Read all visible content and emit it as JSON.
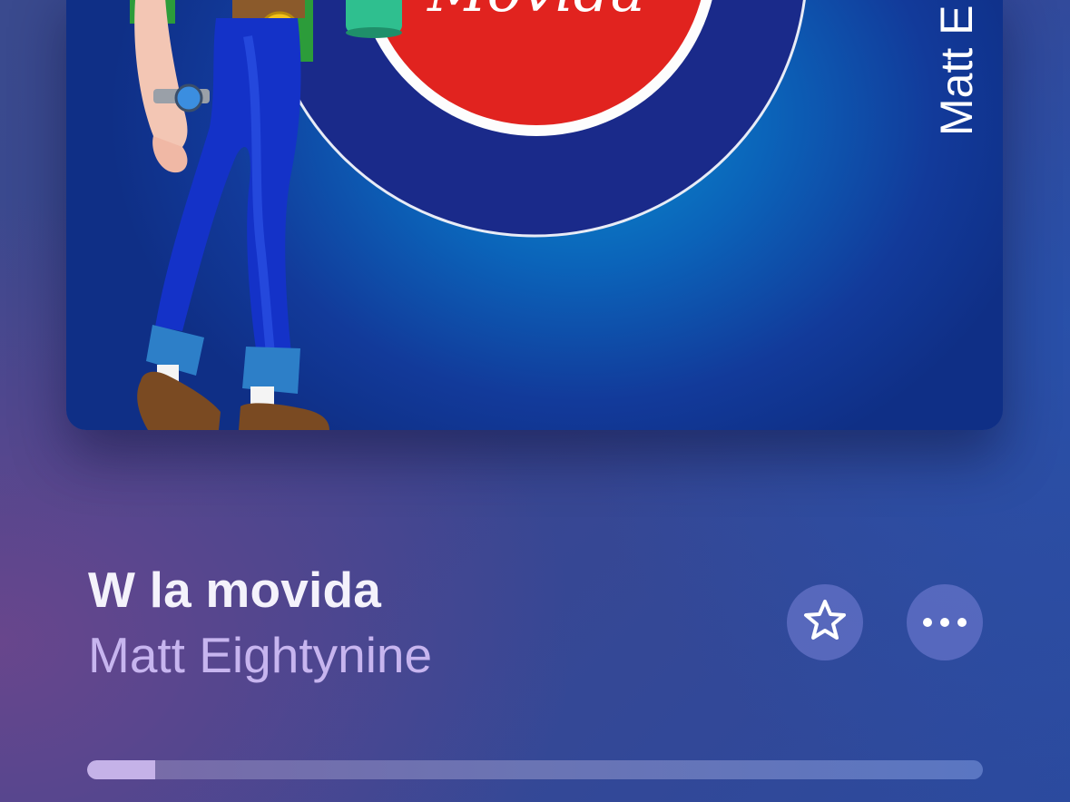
{
  "track": {
    "title": "W la movida",
    "artist": "Matt Eightynine"
  },
  "artwork": {
    "logo_text": "Movida",
    "side_text": "Matt E"
  },
  "player": {
    "progress_fraction": 0.076
  },
  "icons": {
    "favorite": "star-outline-icon",
    "more": "more-dots-icon"
  },
  "colors": {
    "title": "#f4f2fb",
    "artist": "#c7b5ef",
    "progress_fill": "#c5b2e8"
  }
}
